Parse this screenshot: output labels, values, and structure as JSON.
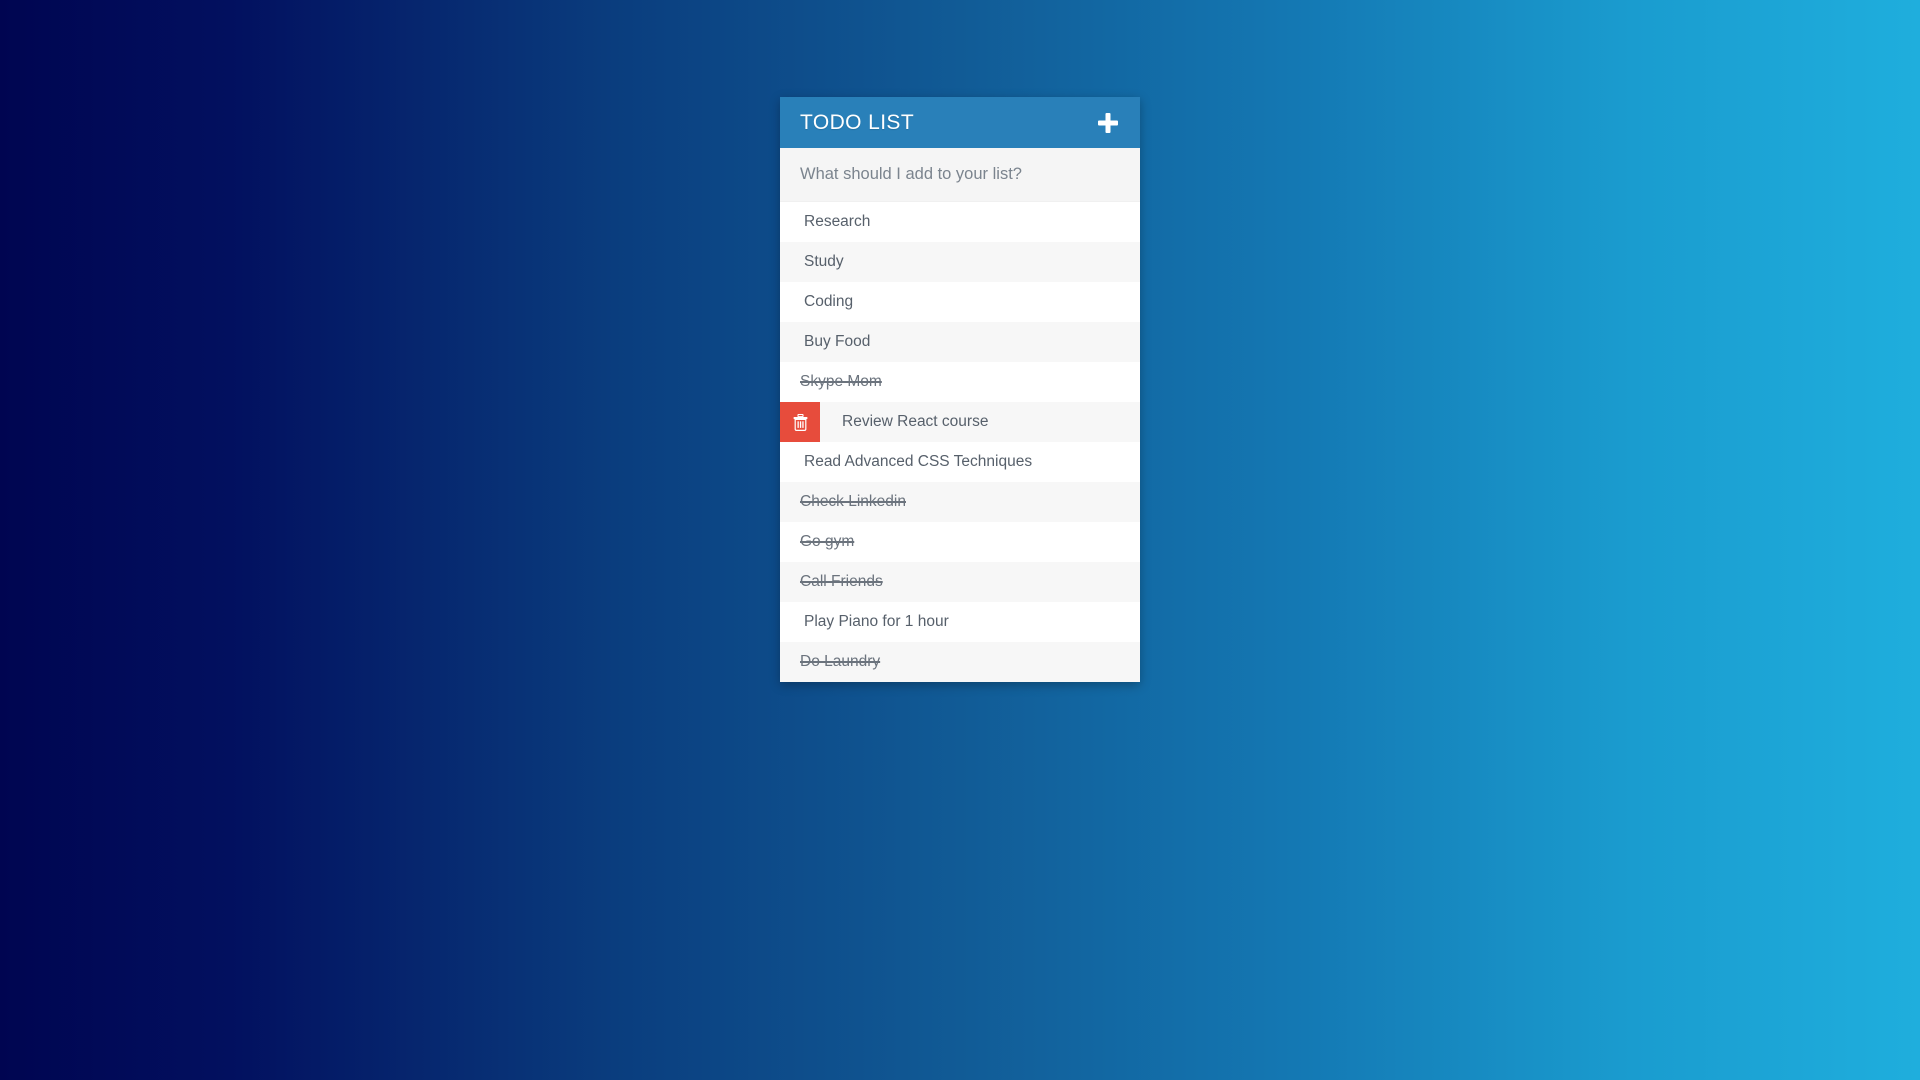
{
  "app": {
    "title": "TODO LIST",
    "accent_color": "#2980b9",
    "delete_color": "#e74c3c",
    "background_gradient_from": "#000551",
    "background_gradient_to": "#1faedd"
  },
  "header": {
    "title": "TODO LIST",
    "add_button_label": "+",
    "add_button_icon": "plus-icon"
  },
  "new_item": {
    "value": "",
    "placeholder": "What should I add to your list?"
  },
  "list": {
    "items": [
      {
        "label": "Research",
        "done": false,
        "show_delete": false
      },
      {
        "label": "Study",
        "done": false,
        "show_delete": false
      },
      {
        "label": "Coding",
        "done": false,
        "show_delete": false
      },
      {
        "label": "Buy Food",
        "done": false,
        "show_delete": false
      },
      {
        "label": "Skype Mom",
        "done": true,
        "show_delete": false
      },
      {
        "label": "Review React course",
        "done": false,
        "show_delete": true
      },
      {
        "label": "Read Advanced CSS Techniques",
        "done": false,
        "show_delete": false
      },
      {
        "label": "Check Linkedin",
        "done": true,
        "show_delete": false
      },
      {
        "label": "Go gym",
        "done": true,
        "show_delete": false
      },
      {
        "label": "Call Friends",
        "done": true,
        "show_delete": false
      },
      {
        "label": "Play Piano for 1 hour",
        "done": false,
        "show_delete": false
      },
      {
        "label": "Do Laundry",
        "done": true,
        "show_delete": false
      }
    ],
    "delete_icon": "trash-icon",
    "delete_button_title": "Delete"
  }
}
